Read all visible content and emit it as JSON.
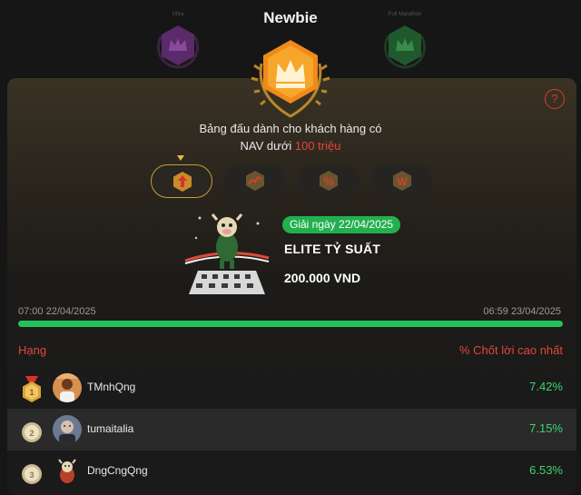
{
  "header": {
    "title": "Newbie",
    "left_tier_label": "Ultra",
    "right_tier_label": "Full Marathon"
  },
  "description": {
    "line1": "Bảng đấu dành cho khách hàng có",
    "line2_prefix": "NAV dưới ",
    "line2_highlight": "100 triệu"
  },
  "tabs": [
    {
      "icon": "up-arrow-icon",
      "active": true
    },
    {
      "icon": "trend-line-icon",
      "active": false
    },
    {
      "icon": "percent-icon",
      "active": false
    },
    {
      "icon": "w-letter-icon",
      "active": false
    }
  ],
  "reward": {
    "date_label": "Giải ngày 22/04/2025",
    "title": "ELITE TỶ SUẤT",
    "amount": "200.000 VND"
  },
  "period": {
    "start": "07:00 22/04/2025",
    "end": "06:59 23/04/2025",
    "progress_percent": 100
  },
  "leaderboard": {
    "rank_header": "Hạng",
    "metric_header": "% Chốt lời cao nhất",
    "rows": [
      {
        "rank": "1",
        "name": "TMnhQng",
        "value": "7.42%"
      },
      {
        "rank": "2",
        "name": "tumaitalia",
        "value": "7.15%"
      },
      {
        "rank": "3",
        "name": "DngCngQng",
        "value": "6.53%"
      }
    ]
  },
  "colors": {
    "accent_red": "#e0483a",
    "accent_green": "#22b04e",
    "gold": "#f5a623"
  }
}
